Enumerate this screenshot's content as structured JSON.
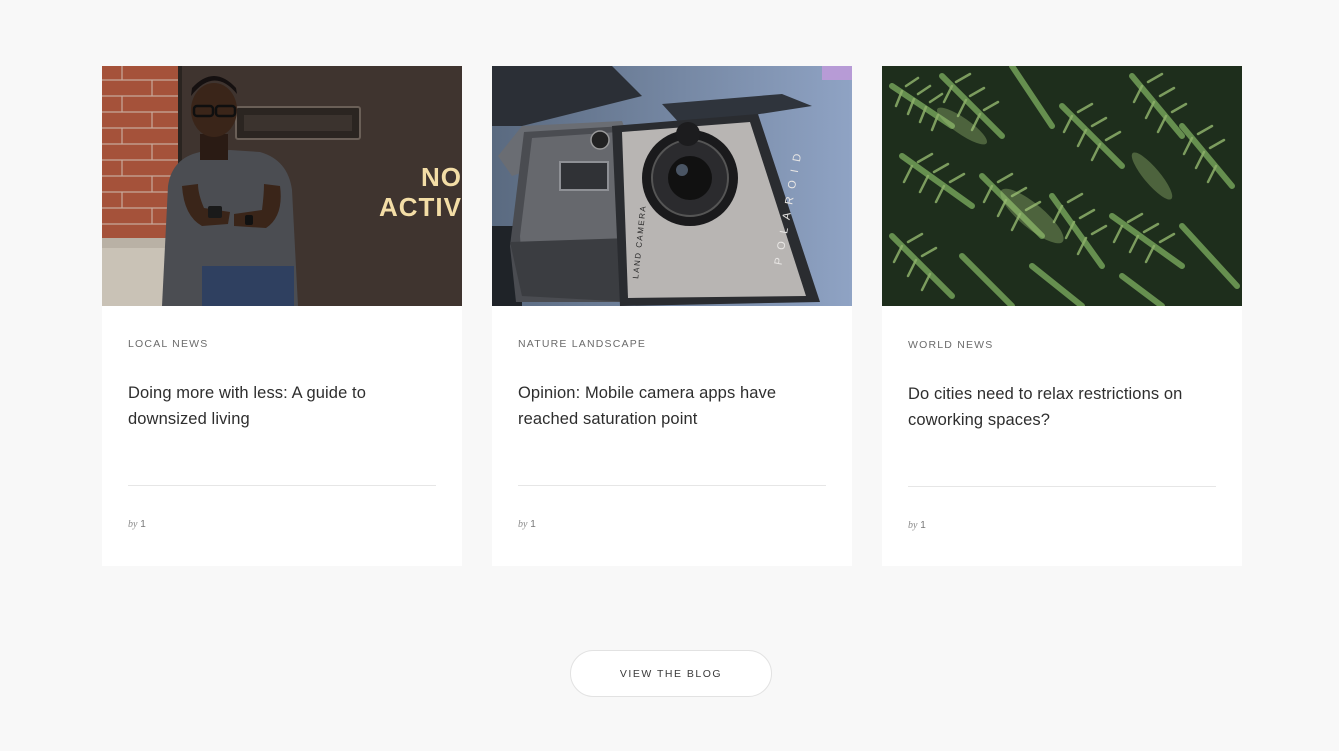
{
  "posts": [
    {
      "category": "LOCAL NEWS",
      "title": "Doing more with less: A guide to downsized living",
      "by_label": "by",
      "author": "1",
      "image_text_1": "NO",
      "image_text_2": "ACTIV"
    },
    {
      "category": "NATURE LANDSCAPE",
      "title": "Opinion: Mobile camera apps have reached saturation point",
      "by_label": "by",
      "author": "1",
      "camera_brand": "POLAROID",
      "camera_model": "LAND CAMERA"
    },
    {
      "category": "WORLD NEWS",
      "title": "Do cities need to relax restrictions on coworking spaces?",
      "by_label": "by",
      "author": "1"
    }
  ],
  "cta": {
    "label": "VIEW THE BLOG"
  },
  "colors": {
    "page_background": "#f8f8f8",
    "card_background": "#ffffff",
    "title_text": "#2e2e2e",
    "meta_text": "#6b6b6b"
  }
}
